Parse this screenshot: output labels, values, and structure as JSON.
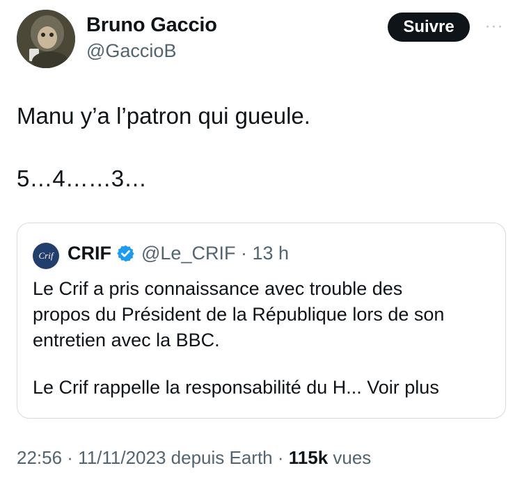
{
  "author": {
    "name": "Bruno Gaccio",
    "handle": "@GaccioB"
  },
  "follow_label": "Suivre",
  "more_label": "···",
  "tweet": {
    "line1": "Manu y’a l’patron qui gueule.",
    "line2": "5…4……3…"
  },
  "quoted": {
    "avatar_text": "Crif",
    "name": "CRIF",
    "handle_time": "@Le_CRIF · 13 h",
    "body": "Le Crif a pris connaissance avec trouble des\npropos du Président de la République lors de son\nentretien avec la BBC.",
    "more_text": "Le Crif rappelle la responsabilité du H... ",
    "more_link": "Voir plus"
  },
  "meta": {
    "time_date": "22:56 · 11/11/2023 depuis Earth · ",
    "views_count": "115k",
    "views_label": " vues"
  },
  "colors": {
    "text": "#0f1419",
    "secondary": "#536471",
    "verified": "#1d9bf0",
    "border": "#d5dce1"
  }
}
